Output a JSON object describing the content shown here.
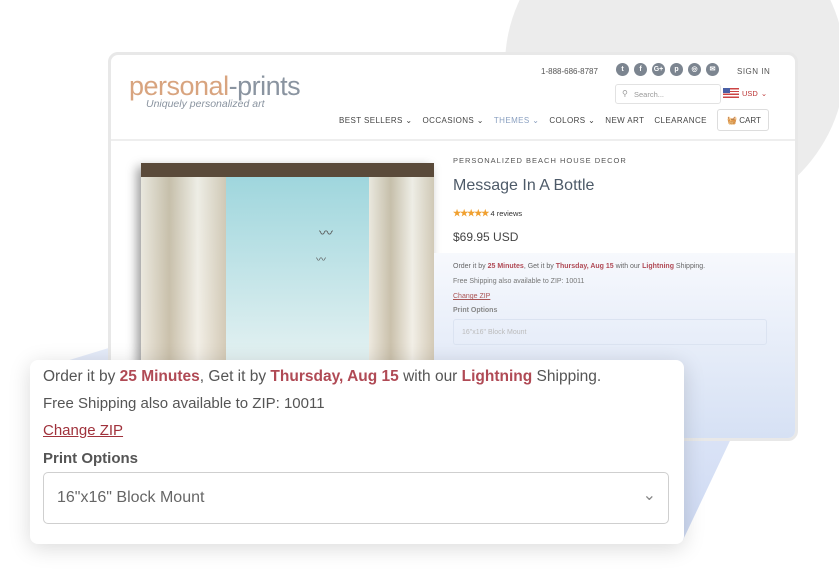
{
  "header": {
    "logo_main": "personal",
    "logo_dash": "-prints",
    "logo_tagline": "Uniquely personalized art",
    "phone": "1-888-686-8787",
    "social": [
      "twitter",
      "facebook",
      "google-plus",
      "pinterest",
      "instagram",
      "email"
    ],
    "sign_in": "SIGN IN",
    "search_placeholder": "Search...",
    "currency": "USD",
    "cart": "CART",
    "nav": [
      {
        "label": "BEST SELLERS ⌄"
      },
      {
        "label": "OCCASIONS ⌄"
      },
      {
        "label": "THEMES ⌄"
      },
      {
        "label": "COLORS ⌄"
      },
      {
        "label": "NEW ART"
      },
      {
        "label": "CLEARANCE"
      }
    ]
  },
  "product": {
    "category": "PERSONALIZED BEACH HOUSE DECOR",
    "title": "Message In A Bottle",
    "stars": "★★★★★",
    "rating": 5,
    "reviews": "4 reviews",
    "price": "$69.95 USD"
  },
  "shipping": {
    "order_pre": "Order it by ",
    "minutes": "25 Minutes",
    "get_by": ", Get it by ",
    "date": "Thursday, Aug 15",
    "with": " with our ",
    "method": "Lightning",
    "post": " Shipping.",
    "free": "Free Shipping also available to ZIP: 10011",
    "change_zip": "Change ZIP",
    "print_options": "Print Options",
    "selected": "16\"x16\" Block Mount"
  },
  "colors": {
    "accent": "#a0323c",
    "wedge": "#c9d6f2",
    "blob": "#ececec"
  }
}
